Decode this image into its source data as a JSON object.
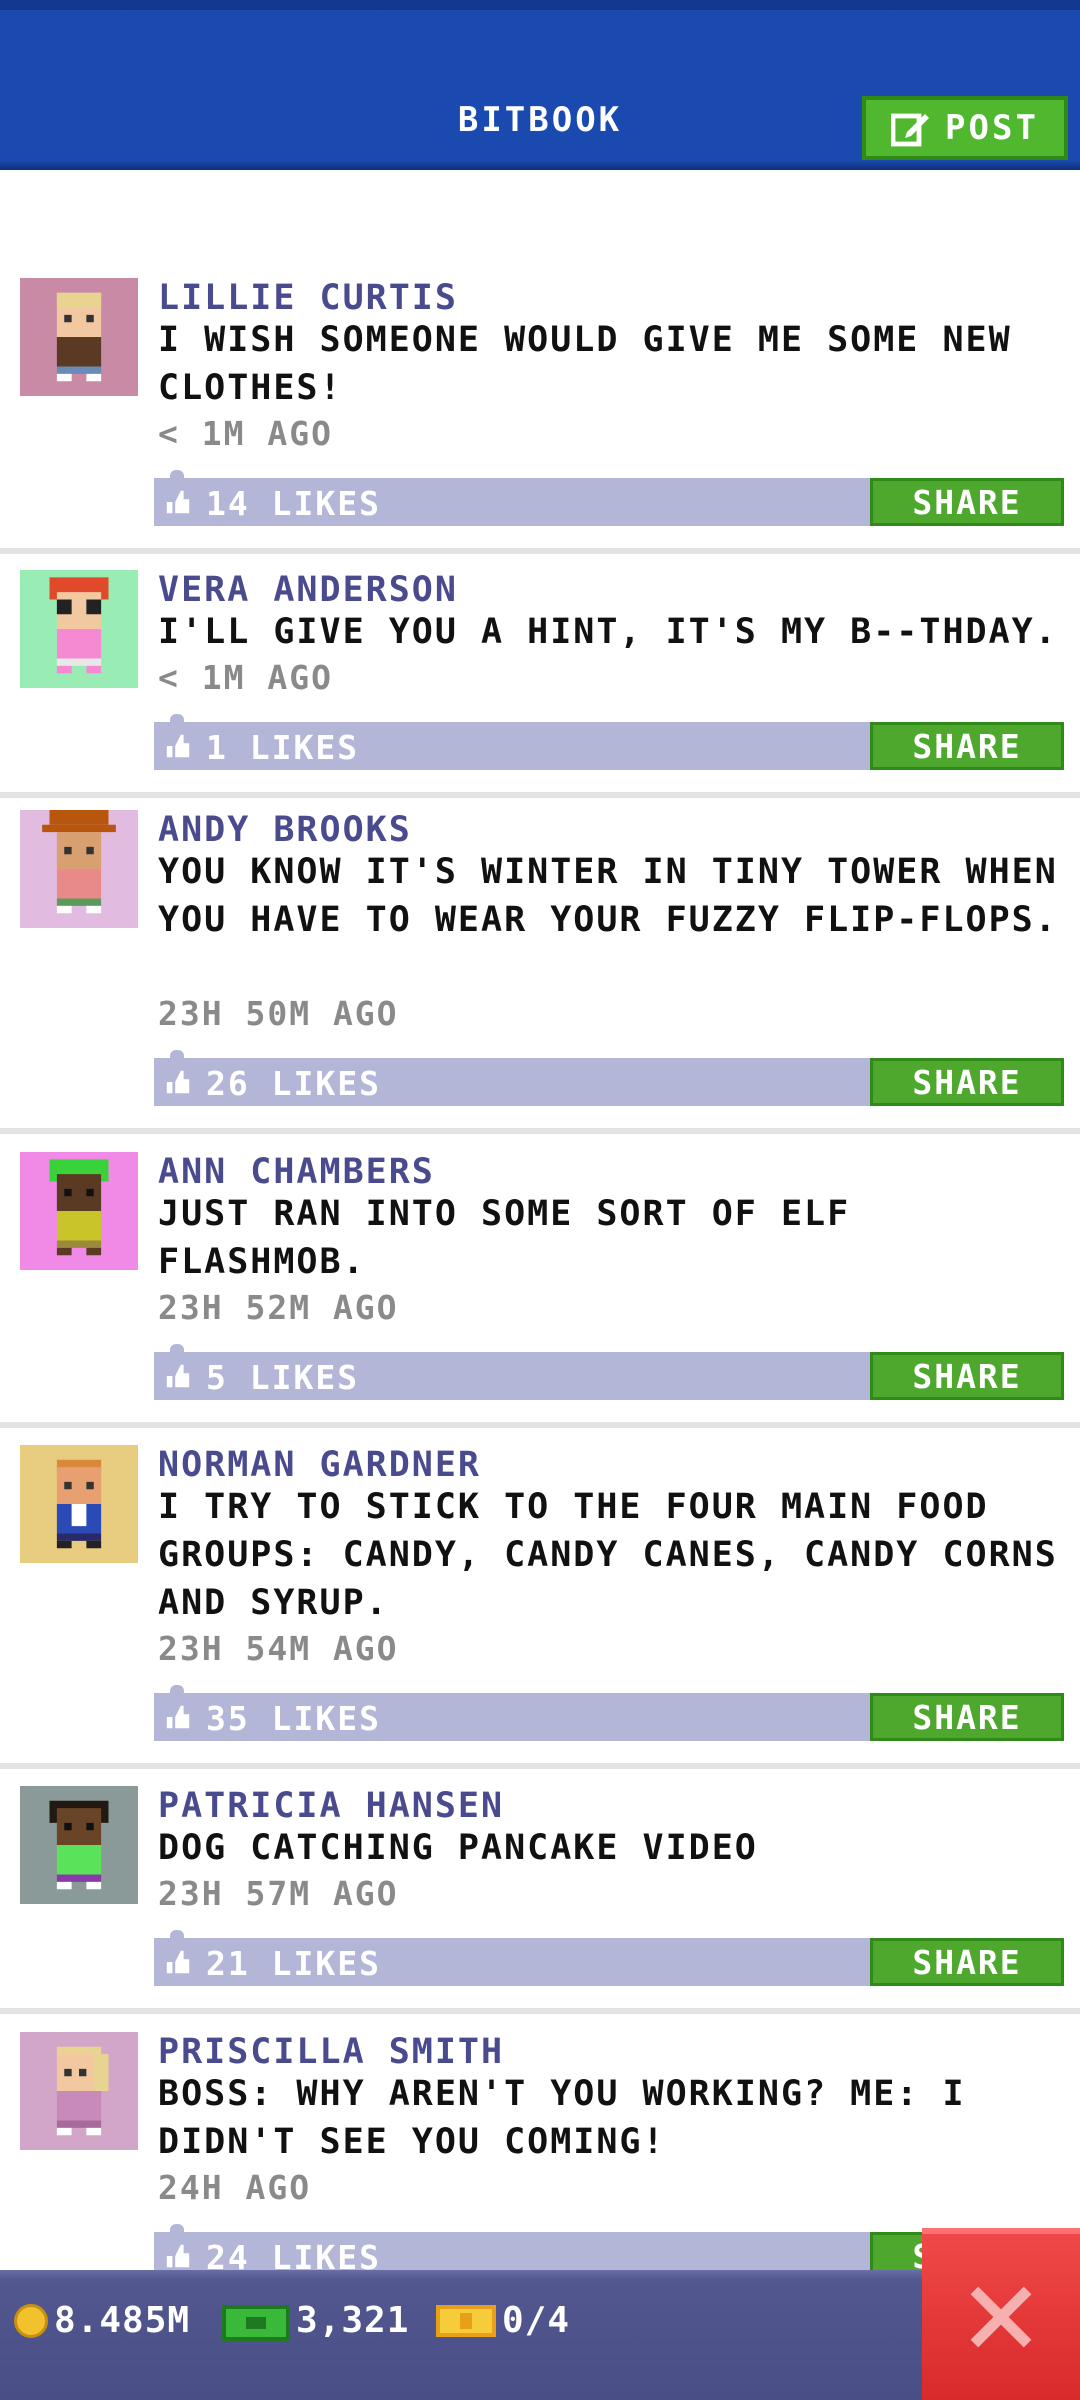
{
  "header": {
    "title": "BITBOOK",
    "post_label": "POST"
  },
  "share_label": "SHARE",
  "posts": [
    {
      "name": "LILLIE CURTIS",
      "text": "I WISH SOMEONE WOULD GIVE ME SOME NEW CLOTHES!",
      "time": "< 1M AGO",
      "likes": "14 LIKES",
      "avatar_bg": "#c98aa6"
    },
    {
      "name": "VERA ANDERSON",
      "text": "I'LL GIVE YOU A HINT, IT'S MY B--THDAY.",
      "time": "< 1M AGO",
      "likes": "1 LIKES",
      "avatar_bg": "#98ecb4"
    },
    {
      "name": "ANDY BROOKS",
      "text": "YOU KNOW IT'S WINTER IN TINY TOWER WHEN YOU HAVE TO WEAR YOUR FUZZY FLIP-FLOPS.",
      "time": "23H 50M AGO",
      "likes": "26 LIKES",
      "avatar_bg": "#e2bce0"
    },
    {
      "name": "ANN CHAMBERS",
      "text": "JUST RAN INTO SOME SORT OF ELF FLASHMOB.",
      "time": "23H 52M AGO",
      "likes": "5 LIKES",
      "avatar_bg": "#f08ae6"
    },
    {
      "name": "NORMAN GARDNER",
      "text": "I TRY TO STICK TO THE FOUR MAIN FOOD GROUPS: CANDY, CANDY CANES, CANDY CORNS AND SYRUP.",
      "time": "23H 54M AGO",
      "likes": "35 LIKES",
      "avatar_bg": "#e8cc80"
    },
    {
      "name": "PATRICIA HANSEN",
      "text": "DOG CATCHING PANCAKE VIDEO",
      "time": "23H 57M AGO",
      "likes": "21 LIKES",
      "avatar_bg": "#8a9a98"
    },
    {
      "name": "PRISCILLA SMITH",
      "text": "BOSS: WHY AREN'T YOU WORKING? ME: I DIDN'T SEE YOU COMING!",
      "time": "24H AGO",
      "likes": "24 LIKES",
      "avatar_bg": "#d2a6c8"
    }
  ],
  "bottom_bar": {
    "coins": "8.485M",
    "bux": "3,321",
    "tickets": "0/4"
  },
  "icons": {
    "post": "edit-icon",
    "like": "thumbs-up-icon",
    "coin": "coin-icon",
    "bux": "bux-icon",
    "ticket": "ticket-icon",
    "close": "close-icon"
  }
}
